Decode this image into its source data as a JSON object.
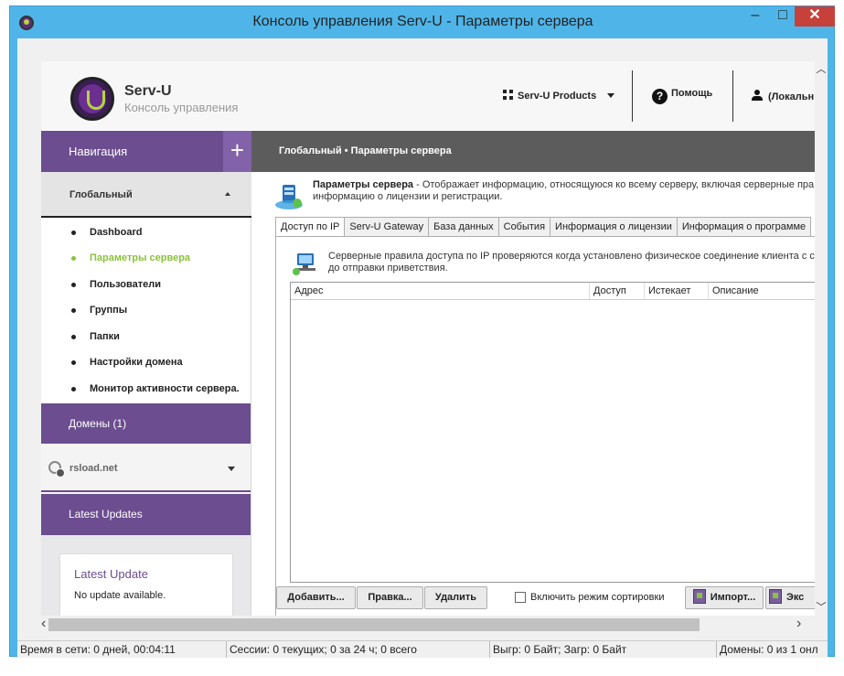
{
  "window": {
    "title": "Консоль управления Serv-U - Параметры сервера",
    "controls": {
      "minimize": "–",
      "maximize": "□",
      "close": "✕"
    }
  },
  "header": {
    "brand": "Serv-U",
    "subtitle": "Консоль управления",
    "products_label": "Serv-U Products",
    "help_label": "Помощь",
    "user_label": "(Локальн"
  },
  "navbar": {
    "title": "Навигация",
    "plus": "+",
    "breadcrumb": "Глобальный  •  Параметры сервера"
  },
  "sidebar": {
    "section": "Глобальный",
    "items": [
      {
        "label": "Dashboard",
        "active": false
      },
      {
        "label": "Параметры сервера",
        "active": true
      },
      {
        "label": "Пользователи",
        "active": false
      },
      {
        "label": "Группы",
        "active": false
      },
      {
        "label": "Папки",
        "active": false
      },
      {
        "label": "Настройки домена",
        "active": false
      },
      {
        "label": "Монитор активности сервера.",
        "active": false
      }
    ],
    "domains_label": "Домены (1)",
    "domain_name": "rsload.net",
    "updates_label": "Latest Updates",
    "update_card_title": "Latest Update",
    "update_card_text": "No update available."
  },
  "main": {
    "desc_title": "Параметры сервера",
    "desc_text": " - Отображает информацию, относящуюся ко всему серверу, включая серверные пра",
    "desc_text2": "информацию о лицензии и регистрации.",
    "tabs": [
      "Доступ по IP",
      "Serv-U Gateway",
      "База данных",
      "События",
      "Информация о лицензии",
      "Информация о программе"
    ],
    "rule_desc_line1": "Серверные правила доступа по IP проверяются когда установлено физическое соединение клиента с с",
    "rule_desc_line2": "до отправки приветствия.",
    "table_headers": [
      "Адрес",
      "Доступ",
      "Истекает",
      "Описание"
    ],
    "buttons": {
      "add": "Добавить...",
      "edit": "Правка...",
      "delete": "Удалить",
      "sort_mode": "Включить режим сортировки",
      "import": "Импорт...",
      "export": "Экс"
    }
  },
  "statusbar": {
    "uptime": "Время в сети: 0 дней, 00:04:11",
    "sessions": "Сессии: 0 текущих; 0 за 24 ч; 0 всего",
    "traffic": "Выгр: 0 Байт; Загр: 0 Байт",
    "domains": "Домены: 0 из 1 онл"
  },
  "colors": {
    "purple": "#6c4d8f",
    "accent_green": "#8bc13b",
    "window_border": "#4fb5e8",
    "close_red": "#c7413b"
  }
}
